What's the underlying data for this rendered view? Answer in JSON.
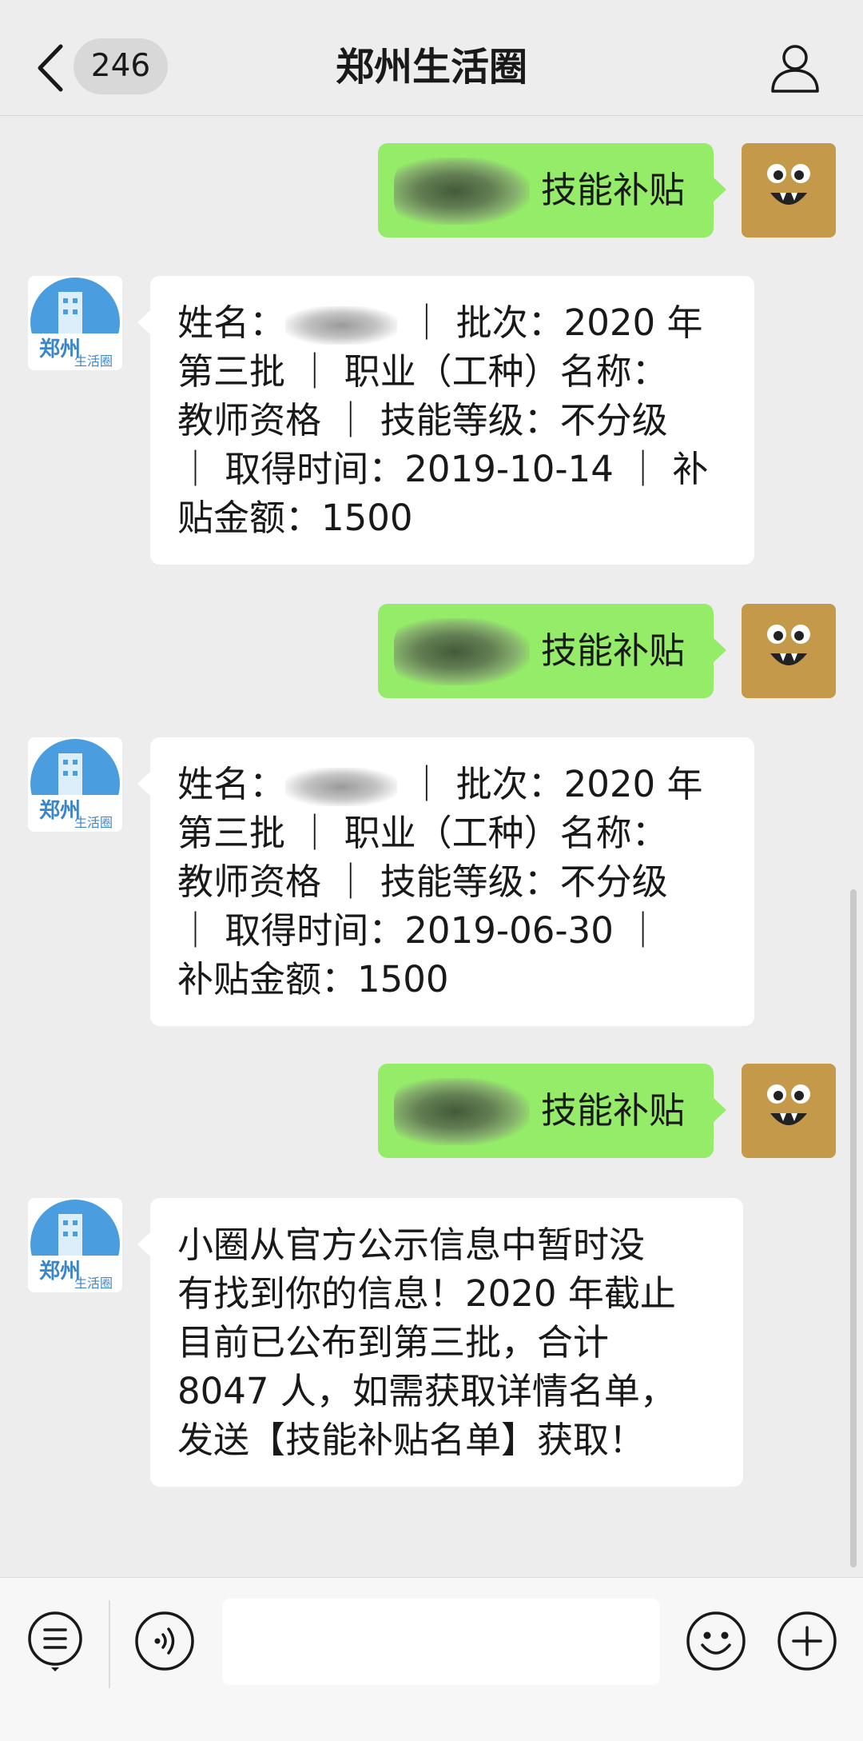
{
  "header": {
    "back_icon": "chevron-left-icon",
    "unread_count": "246",
    "title": "郑州生活圈",
    "profile_icon": "person-icon"
  },
  "messages": [
    {
      "side": "out",
      "text": "技能补贴",
      "redacted_prefix": true
    },
    {
      "side": "in",
      "lines": [
        "姓名：",
        " ｜ 批次：2020 年",
        "第三批 ｜ 职业（工种）名称：",
        "教师资格 ｜ 技能等级：不分级",
        " ｜ 取得时间：2019-10-14 ｜ 补",
        "贴金额：1500"
      ]
    },
    {
      "side": "out",
      "text": "技能补贴",
      "redacted_prefix": true
    },
    {
      "side": "in",
      "lines": [
        "姓名：",
        " ｜ 批次：2020 年",
        "第三批 ｜ 职业（工种）名称：",
        "教师资格 ｜ 技能等级：不分级",
        " ｜ 取得时间：2019-06-30 ｜",
        "补贴金额：1500"
      ]
    },
    {
      "side": "out",
      "text": "技能补贴",
      "redacted_prefix": true
    },
    {
      "side": "in",
      "text": "小圈从官方公示信息中暂时没\n有找到你的信息！2020 年截止\n目前已公布到第三批，合计\n8047 人，如需获取详情名单，\n发送【技能补贴名单】获取！"
    }
  ],
  "bot_avatar_text": "郑州生活圈",
  "input": {
    "placeholder": "",
    "value": ""
  },
  "toolbar": {
    "menu_icon": "menu-list-icon",
    "voice_icon": "voice-icon",
    "emoji_icon": "emoji-icon",
    "plus_icon": "plus-icon"
  },
  "colors": {
    "background": "#ededed",
    "outgoing_bubble": "#95ec69",
    "incoming_bubble": "#ffffff",
    "user_avatar": "#c49a4a",
    "bot_avatar_accent": "#4a9ee0"
  }
}
